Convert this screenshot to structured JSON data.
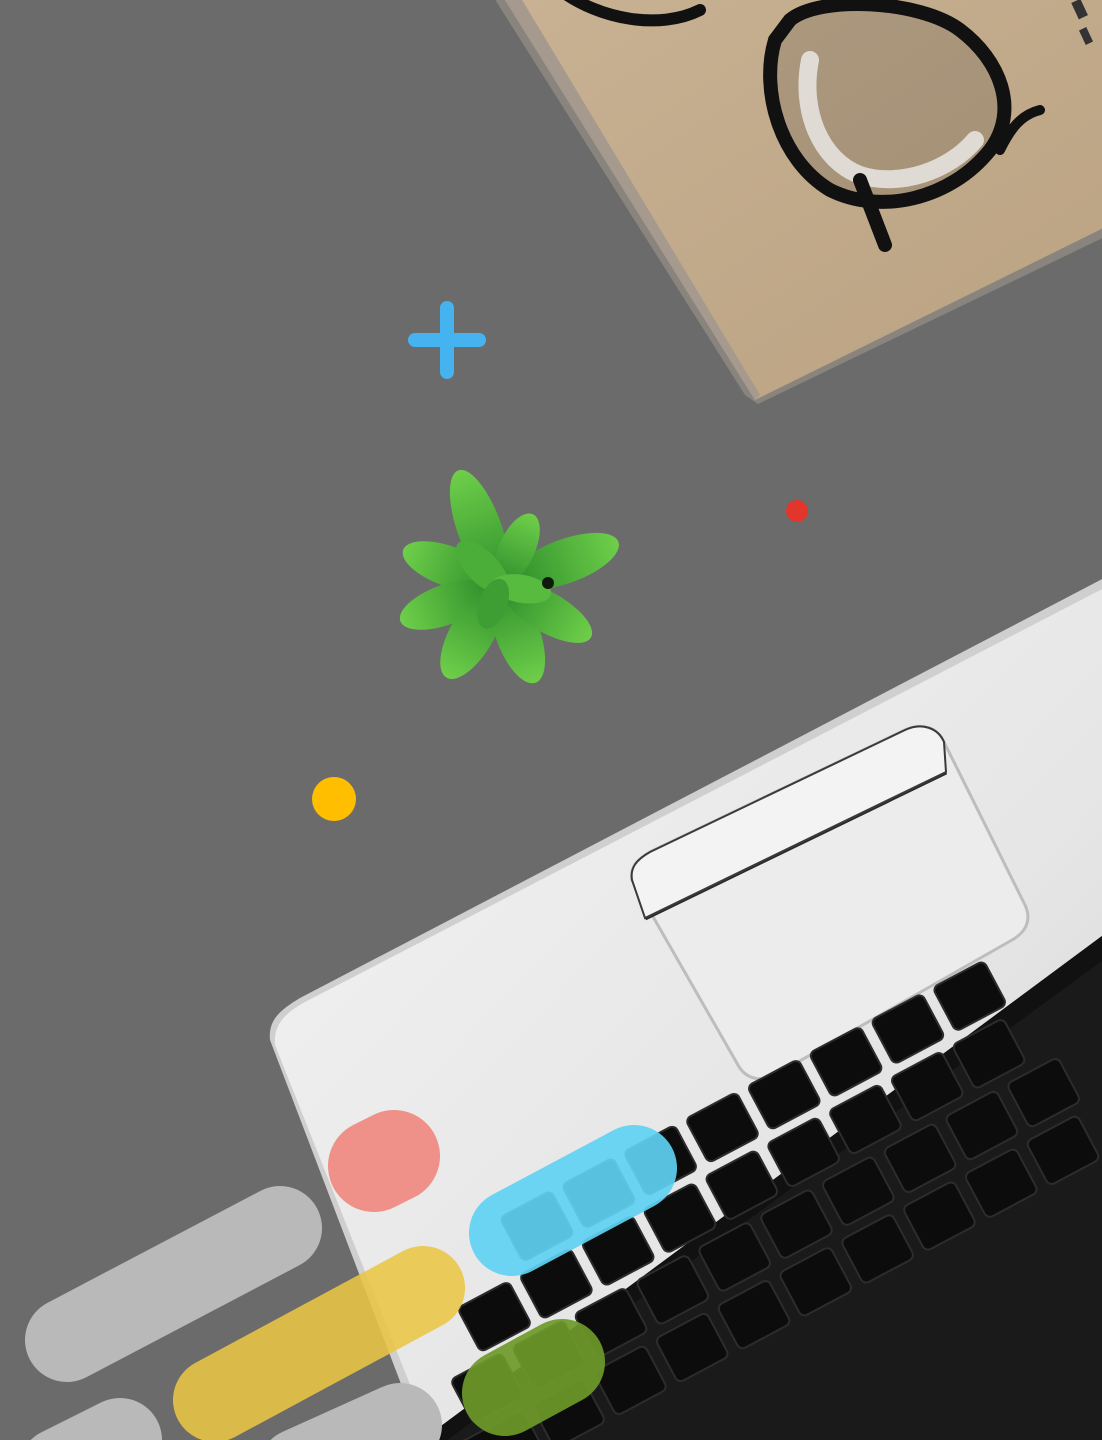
{
  "scene": {
    "background_color": "#6b6b6b",
    "objects": [
      "notebook",
      "eyeglasses",
      "succulent-plant",
      "laptop",
      "keyboard",
      "trackpad"
    ],
    "decorations": {
      "plus_color": "#45b3f0",
      "red_dot_color": "#e2352c",
      "yellow_dot_color": "#ffbf00",
      "pill_colors": {
        "gray": "#b9b9b9",
        "coral": "#ef8c84",
        "blue": "#5ed1f2",
        "yellow": "#e9c543",
        "green": "#6f9a2a"
      }
    }
  }
}
